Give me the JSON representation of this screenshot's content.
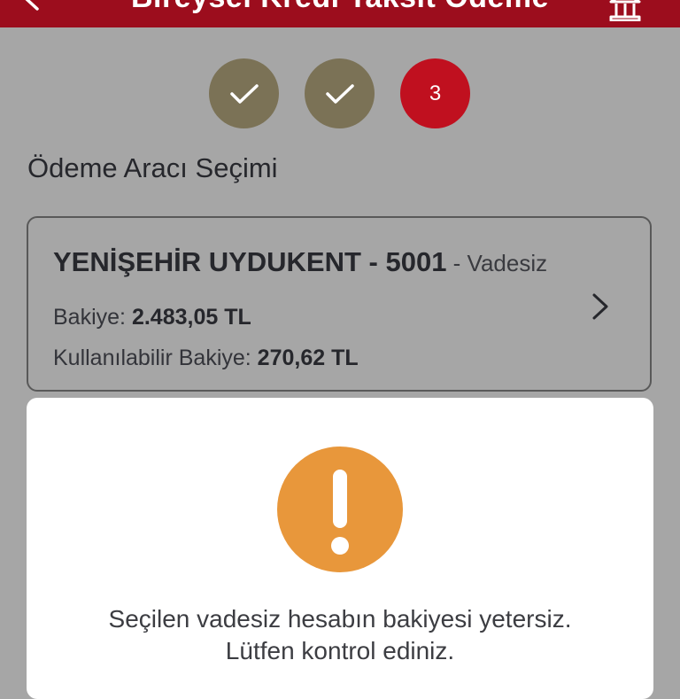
{
  "header": {
    "title": "Bireysel Kredi Taksit Ödeme",
    "back_icon": "chevron-left-icon",
    "right_icon": "bank-icon",
    "color": "#9c0d1d"
  },
  "steps": [
    {
      "state": "done",
      "icon": "check-icon"
    },
    {
      "state": "done",
      "icon": "check-icon"
    },
    {
      "state": "active",
      "label": "3"
    }
  ],
  "section": {
    "title": "Ödeme Aracı Seçimi"
  },
  "account": {
    "name": "YENİŞEHİR UYDUKENT - 5001",
    "type": " - Vadesiz",
    "balance_label": "Bakiye: ",
    "balance_value": "2.483,05 TL",
    "available_label": "Kullanılabilir Bakiye: ",
    "available_value": "270,62 TL",
    "icon": "chevron-right-icon"
  },
  "alert": {
    "icon": "exclamation-icon",
    "color": "#e8973b",
    "line1": "Seçilen vadesiz hesabın bakiyesi yetersiz.",
    "line2": "Lütfen kontrol ediniz."
  }
}
